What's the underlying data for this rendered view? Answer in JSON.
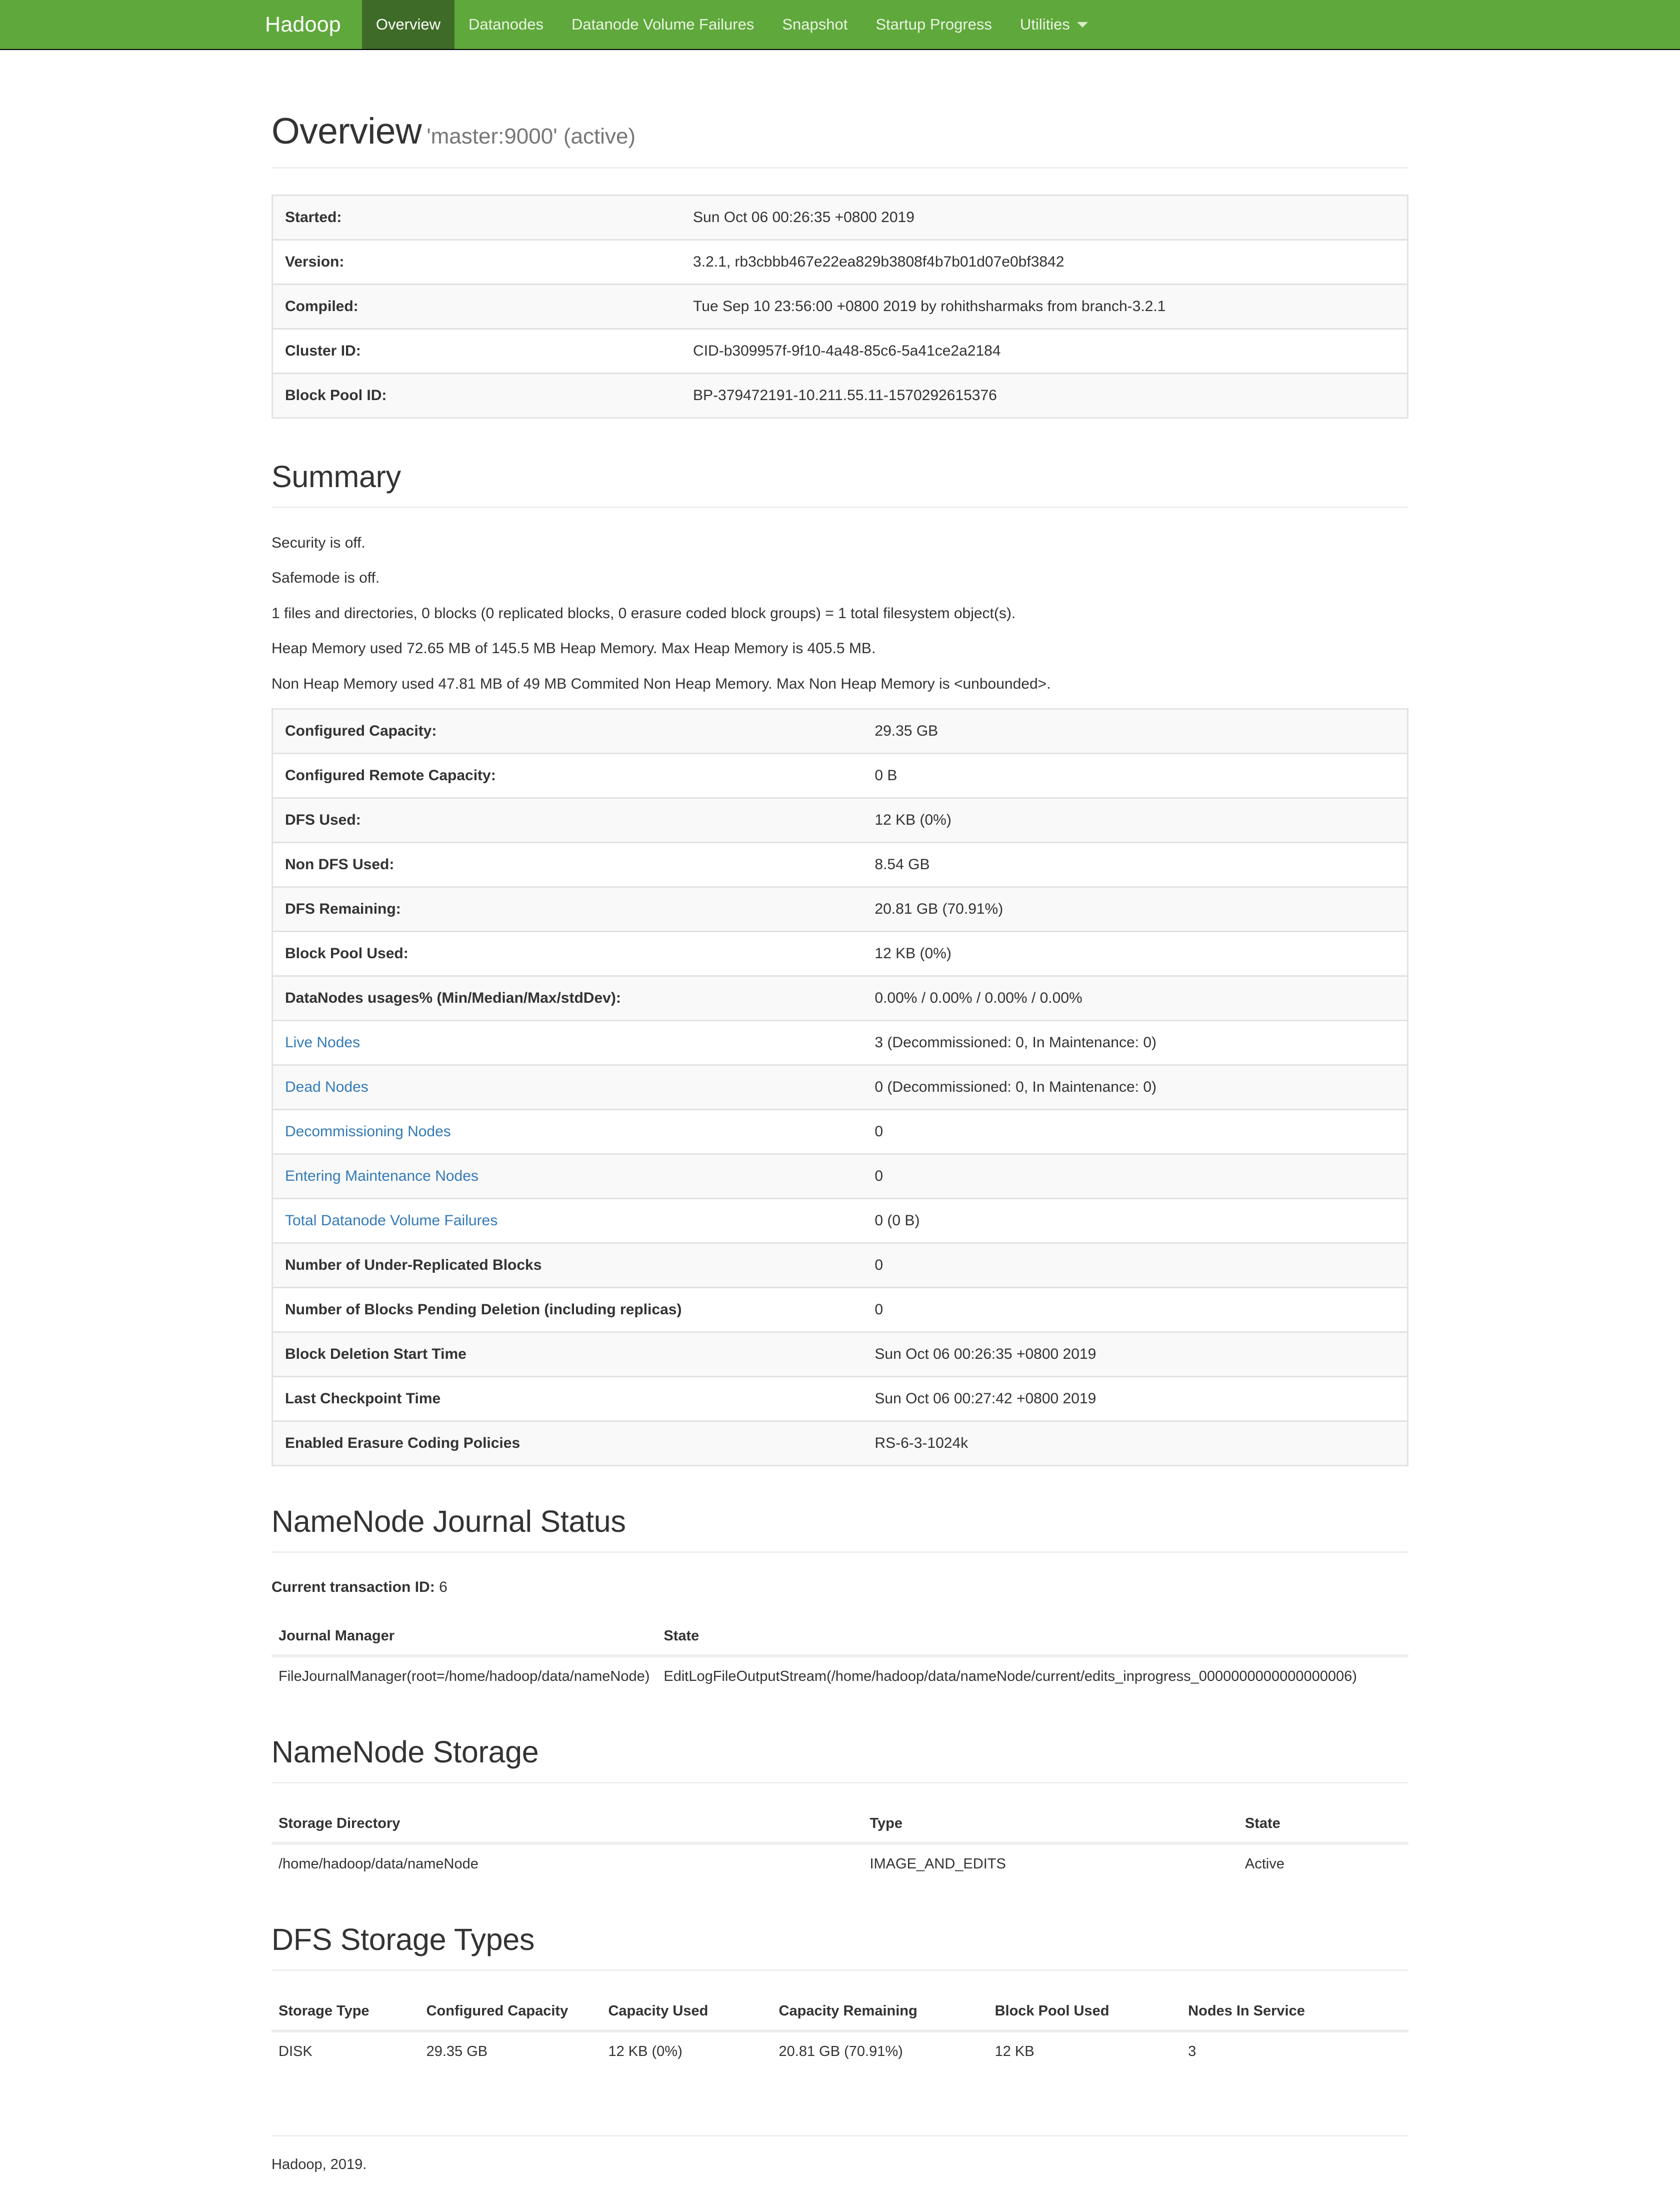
{
  "navbar": {
    "brand": "Hadoop",
    "items": [
      {
        "label": "Overview",
        "active": true
      },
      {
        "label": "Datanodes",
        "active": false
      },
      {
        "label": "Datanode Volume Failures",
        "active": false
      },
      {
        "label": "Snapshot",
        "active": false
      },
      {
        "label": "Startup Progress",
        "active": false
      },
      {
        "label": "Utilities",
        "active": false,
        "caret": true
      }
    ],
    "colors": {
      "bar": "#5fa83c",
      "active": "#3f6b28",
      "text": "#eaf4e2"
    }
  },
  "page": {
    "title": "Overview",
    "subtitle": "'master:9000' (active)"
  },
  "info_table": {
    "rows": [
      {
        "key": "Started:",
        "value": "Sun Oct 06 00:26:35 +0800 2019"
      },
      {
        "key": "Version:",
        "value": "3.2.1, rb3cbbb467e22ea829b3808f4b7b01d07e0bf3842"
      },
      {
        "key": "Compiled:",
        "value": "Tue Sep 10 23:56:00 +0800 2019 by rohithsharmaks from branch-3.2.1"
      },
      {
        "key": "Cluster ID:",
        "value": "CID-b309957f-9f10-4a48-85c6-5a41ce2a2184"
      },
      {
        "key": "Block Pool ID:",
        "value": "BP-379472191-10.211.55.11-1570292615376"
      }
    ]
  },
  "summary": {
    "heading": "Summary",
    "paragraphs": [
      "Security is off.",
      "Safemode is off.",
      "1 files and directories, 0 blocks (0 replicated blocks, 0 erasure coded block groups) = 1 total filesystem object(s).",
      "Heap Memory used 72.65 MB of 145.5 MB Heap Memory. Max Heap Memory is 405.5 MB.",
      "Non Heap Memory used 47.81 MB of 49 MB Commited Non Heap Memory. Max Non Heap Memory is <unbounded>."
    ],
    "rows": [
      {
        "key": "Configured Capacity:",
        "value": "29.35 GB",
        "link": false
      },
      {
        "key": "Configured Remote Capacity:",
        "value": "0 B",
        "link": false
      },
      {
        "key": "DFS Used:",
        "value": "12 KB (0%)",
        "link": false
      },
      {
        "key": "Non DFS Used:",
        "value": "8.54 GB",
        "link": false
      },
      {
        "key": "DFS Remaining:",
        "value": "20.81 GB (70.91%)",
        "link": false
      },
      {
        "key": "Block Pool Used:",
        "value": "12 KB (0%)",
        "link": false
      },
      {
        "key": "DataNodes usages% (Min/Median/Max/stdDev):",
        "value": "0.00% / 0.00% / 0.00% / 0.00%",
        "link": false
      },
      {
        "key": "Live Nodes",
        "value": "3 (Decommissioned: 0, In Maintenance: 0)",
        "link": true
      },
      {
        "key": "Dead Nodes",
        "value": "0 (Decommissioned: 0, In Maintenance: 0)",
        "link": true
      },
      {
        "key": "Decommissioning Nodes",
        "value": "0",
        "link": true
      },
      {
        "key": "Entering Maintenance Nodes",
        "value": "0",
        "link": true
      },
      {
        "key": "Total Datanode Volume Failures",
        "value": "0 (0 B)",
        "link": true
      },
      {
        "key": "Number of Under-Replicated Blocks",
        "value": "0",
        "link": false
      },
      {
        "key": "Number of Blocks Pending Deletion (including replicas)",
        "value": "0",
        "link": false
      },
      {
        "key": "Block Deletion Start Time",
        "value": "Sun Oct 06 00:26:35 +0800 2019",
        "link": false
      },
      {
        "key": "Last Checkpoint Time",
        "value": "Sun Oct 06 00:27:42 +0800 2019",
        "link": false
      },
      {
        "key": "Enabled Erasure Coding Policies",
        "value": "RS-6-3-1024k",
        "link": false
      }
    ],
    "link_color": "#337ab7"
  },
  "journal": {
    "heading": "NameNode Journal Status",
    "txn_label": "Current transaction ID:",
    "txn_value": "6",
    "headers": [
      "Journal Manager",
      "State"
    ],
    "rows": [
      [
        "FileJournalManager(root=/home/hadoop/data/nameNode)",
        "EditLogFileOutputStream(/home/hadoop/data/nameNode/current/edits_inprogress_0000000000000000006)"
      ]
    ]
  },
  "storage": {
    "heading": "NameNode Storage",
    "headers": [
      "Storage Directory",
      "Type",
      "State"
    ],
    "rows": [
      [
        "/home/hadoop/data/nameNode",
        "IMAGE_AND_EDITS",
        "Active"
      ]
    ]
  },
  "dfs_storage_types": {
    "heading": "DFS Storage Types",
    "headers": [
      "Storage Type",
      "Configured Capacity",
      "Capacity Used",
      "Capacity Remaining",
      "Block Pool Used",
      "Nodes In Service"
    ],
    "rows": [
      [
        "DISK",
        "29.35 GB",
        "12 KB (0%)",
        "20.81 GB (70.91%)",
        "12 KB",
        "3"
      ]
    ]
  },
  "footer": {
    "text": "Hadoop, 2019."
  }
}
